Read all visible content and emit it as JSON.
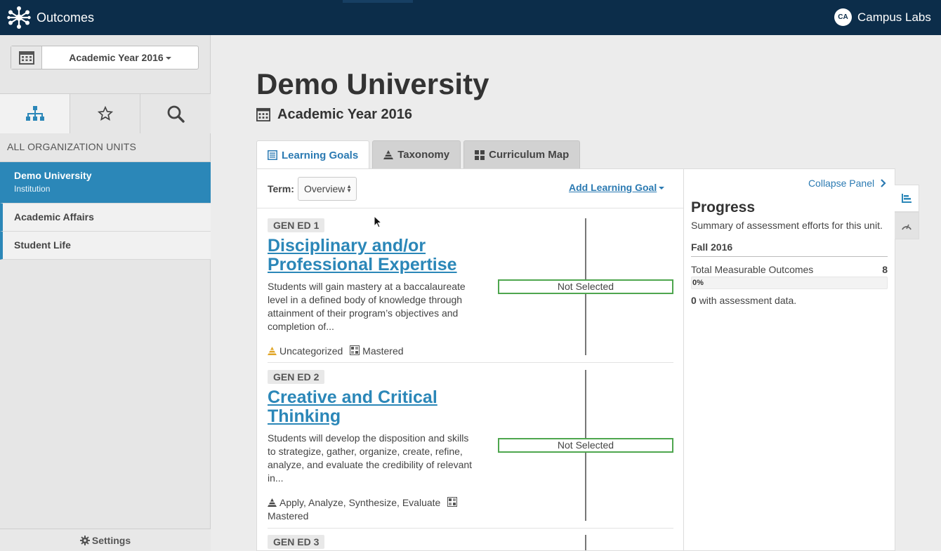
{
  "topbar": {
    "app_title": "Outcomes",
    "user_initials": "CA",
    "user_name": "Campus Labs"
  },
  "sidebar": {
    "year_selector": "Academic Year 2016",
    "units_heading": "ALL ORGANIZATION UNITS",
    "units": [
      {
        "name": "Demo University",
        "type": "Institution",
        "active": true
      },
      {
        "name": "Academic Affairs"
      },
      {
        "name": "Student Life"
      }
    ],
    "settings_label": "Settings"
  },
  "main": {
    "title": "Demo University",
    "subtitle": "Academic Year 2016",
    "tabs": [
      {
        "label": "Learning Goals",
        "active": true
      },
      {
        "label": "Taxonomy"
      },
      {
        "label": "Curriculum Map"
      }
    ],
    "term_label": "Term:",
    "term_value": "Overview",
    "add_goal_label": "Add Learning Goal",
    "goals": [
      {
        "tag": "GEN ED 1",
        "title": "Disciplinary and/or Professional Expertise",
        "description": "Students will gain mastery at a baccalaureate level in a defined body of knowledge through attainment of their program’s objectives and completion of...",
        "taxonomy": "Uncategorized",
        "mapping": "Mastered",
        "status": "Not Selected"
      },
      {
        "tag": "GEN ED 2",
        "title": "Creative and Critical Thinking",
        "description": "Students will develop the disposition and skills to strategize, gather, organize, create, refine, analyze, and evaluate the credibility of relevant in...",
        "taxonomy": "Apply, Analyze, Synthesize, Evaluate",
        "mapping": "Mastered",
        "status": "Not Selected"
      },
      {
        "tag": "GEN ED 3"
      }
    ]
  },
  "progress": {
    "collapse_label": "Collapse Panel",
    "title": "Progress",
    "subtitle": "Summary of assessment efforts for this unit.",
    "term": "Fall 2016",
    "total_label": "Total Measurable Outcomes",
    "total_count": "8",
    "percent_label": "0%",
    "percent_value": 0,
    "data_count": "0",
    "data_label": "with assessment data."
  },
  "colors": {
    "topbar": "#0c2d4a",
    "accent": "#2b87b8",
    "link": "#2b7ab2",
    "status_border": "#4ea64e",
    "warning_icon": "#e0a526"
  }
}
